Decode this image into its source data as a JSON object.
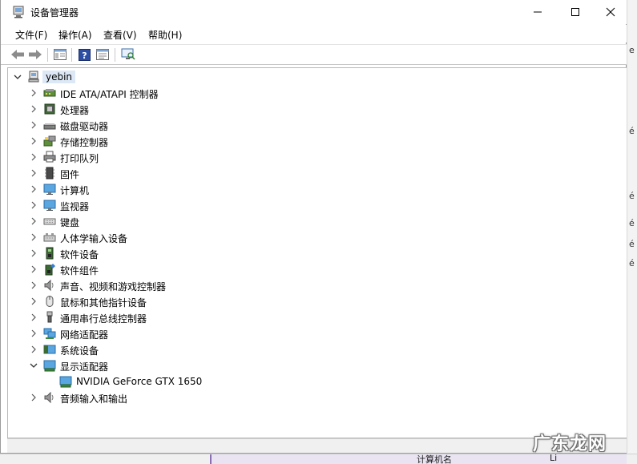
{
  "window": {
    "title": "设备管理器"
  },
  "menu": [
    {
      "label": "文件(F)"
    },
    {
      "label": "操作(A)"
    },
    {
      "label": "查看(V)"
    },
    {
      "label": "帮助(H)"
    }
  ],
  "toolbar": {
    "buttons": [
      "back-arrow-icon",
      "forward-arrow-icon",
      "console-tree-icon",
      "help-icon",
      "properties-icon",
      "scan-hardware-icon"
    ]
  },
  "tree": {
    "root": {
      "label": "yebin",
      "expanded": true,
      "icon": "computer-icon"
    },
    "categories": [
      {
        "label": "IDE ATA/ATAPI 控制器",
        "icon": "ide-controller-icon"
      },
      {
        "label": "处理器",
        "icon": "processor-icon"
      },
      {
        "label": "磁盘驱动器",
        "icon": "disk-drive-icon"
      },
      {
        "label": "存储控制器",
        "icon": "storage-controller-icon"
      },
      {
        "label": "打印队列",
        "icon": "printer-icon"
      },
      {
        "label": "固件",
        "icon": "firmware-icon"
      },
      {
        "label": "计算机",
        "icon": "monitor-icon"
      },
      {
        "label": "监视器",
        "icon": "monitor-icon"
      },
      {
        "label": "键盘",
        "icon": "keyboard-icon"
      },
      {
        "label": "人体学输入设备",
        "icon": "hid-icon"
      },
      {
        "label": "软件设备",
        "icon": "software-device-icon"
      },
      {
        "label": "软件组件",
        "icon": "software-component-icon"
      },
      {
        "label": "声音、视频和游戏控制器",
        "icon": "speaker-icon"
      },
      {
        "label": "鼠标和其他指针设备",
        "icon": "mouse-icon"
      },
      {
        "label": "通用串行总线控制器",
        "icon": "usb-icon"
      },
      {
        "label": "网络适配器",
        "icon": "network-adapter-icon"
      },
      {
        "label": "系统设备",
        "icon": "system-device-icon"
      },
      {
        "label": "显示适配器",
        "icon": "display-adapter-icon",
        "expanded": true,
        "children": [
          {
            "label": "NVIDIA GeForce GTX 1650",
            "icon": "display-adapter-icon"
          }
        ]
      },
      {
        "label": "音频输入和输出",
        "icon": "speaker-icon"
      }
    ]
  },
  "background": {
    "right_fragments": [
      "e",
      "é",
      "é",
      "é",
      "é",
      "é"
    ],
    "bottom_fragments": [
      "计算机名",
      "Li"
    ]
  },
  "watermark": "广东龙网",
  "colors": {
    "selection": "#dde8f6",
    "border": "#b9b9b9",
    "chevron": "#555555"
  }
}
